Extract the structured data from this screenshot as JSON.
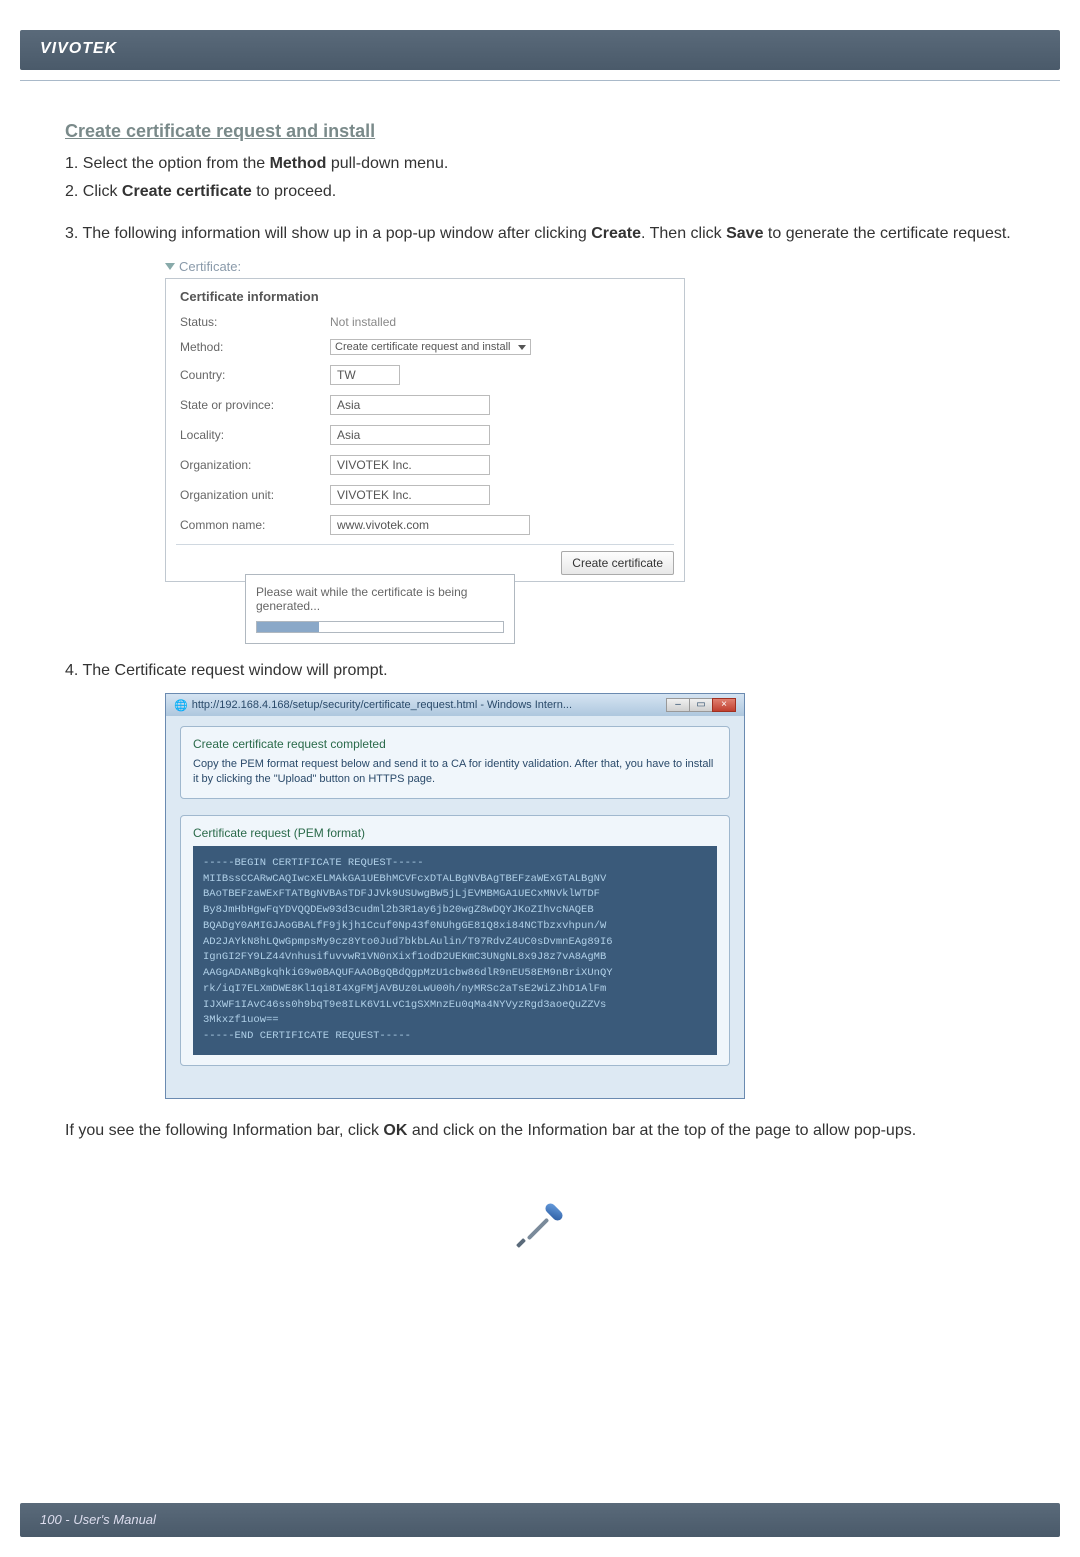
{
  "brand": "VIVOTEK",
  "section_title": "Create certificate request and install",
  "steps": {
    "s1_a": "1. Select the option from the ",
    "s1_b": "Method",
    "s1_c": " pull-down menu.",
    "s2_a": "2. Click ",
    "s2_b": "Create certificate",
    "s2_c": " to proceed.",
    "s3_a": "3. The following information will show up in a pop-up window after clicking ",
    "s3_b": "Create",
    "s3_c": ". Then click ",
    "s3_d": "Save",
    "s3_e": " to generate the certificate request.",
    "s4": "4. The Certificate request window will prompt."
  },
  "cert_panel": {
    "header_label": "Certificate:",
    "title": "Certificate information",
    "rows": {
      "status_label": "Status:",
      "status_val": "Not installed",
      "method_label": "Method:",
      "method_val": "Create certificate request and install",
      "country_label": "Country:",
      "country_val": "TW",
      "state_label": "State or province:",
      "state_val": "Asia",
      "locality_label": "Locality:",
      "locality_val": "Asia",
      "org_label": "Organization:",
      "org_val": "VIVOTEK Inc.",
      "orgunit_label": "Organization unit:",
      "orgunit_val": "VIVOTEK Inc.",
      "cn_label": "Common name:",
      "cn_val": "www.vivotek.com"
    },
    "button": "Create certificate",
    "progress_text": "Please wait while the certificate is being generated..."
  },
  "ie_window": {
    "title": "http://192.168.4.168/setup/security/certificate_request.html - Windows Intern...",
    "completed": "Create certificate request completed",
    "instruction": "Copy the PEM format request below and send it to a CA for identity validation. After that, you have to install it by clicking the \"Upload\" button on HTTPS page.",
    "pem_legend": "Certificate request (PEM format)",
    "pem_lines": [
      "-----BEGIN CERTIFICATE REQUEST-----",
      "MIIBssCCARwCAQIwcxELMAkGA1UEBhMCVFcxDTALBgNVBAgTBEFzaWExGTALBgNV",
      "BAoTBEFzaWExFTATBgNVBAsTDFJJVk9USUwgBW5jLjEVMBMGA1UECxMNVklWTDF",
      "By8JmHbHgwFqYDVQQDEw93d3cudml2b3R1ay6jb20wgZ8wDQYJKoZIhvcNAQEB",
      "BQADgY0AMIGJAoGBALfF9jkjh1Ccuf0Np43f0NUhgGE81Q8xi84NCTbzxvhpun/W",
      "AD2JAYkN8hLQwGpmpsMy9cz8Yto0Jud7bkbLAulin/T97RdvZ4UC0sDvmnEAg89I6",
      "IgnGI2FY9LZ44VnhusifuvvwR1VN0nXixf1odD2UEKmC3UNgNL8x9J8z7vA8AgMB",
      "AAGgADANBgkqhkiG9w0BAQUFAAOBgQBdQgpMzU1cbw86dlR9nEU58EM9nBriXUnQY",
      "rk/iqI7ELXmDWE8Kl1qi8I4XgFMjAVBUz0LwU00h/nyMRSc2aTsE2WiZJhD1AlFm",
      "IJXWF1IAvC46ss0h9bqT9e8ILK6V1LvC1gSXMnzEu0qMa4NYVyzRgd3aoeQuZZVs",
      "3Mkxzf1uow==",
      "-----END CERTIFICATE REQUEST-----"
    ]
  },
  "below_text_a": "If you see the following Information bar, click ",
  "below_text_b": "OK",
  "below_text_c": " and click on the Information bar at the top of the page to allow pop-ups.",
  "footer": "100 - User's Manual"
}
